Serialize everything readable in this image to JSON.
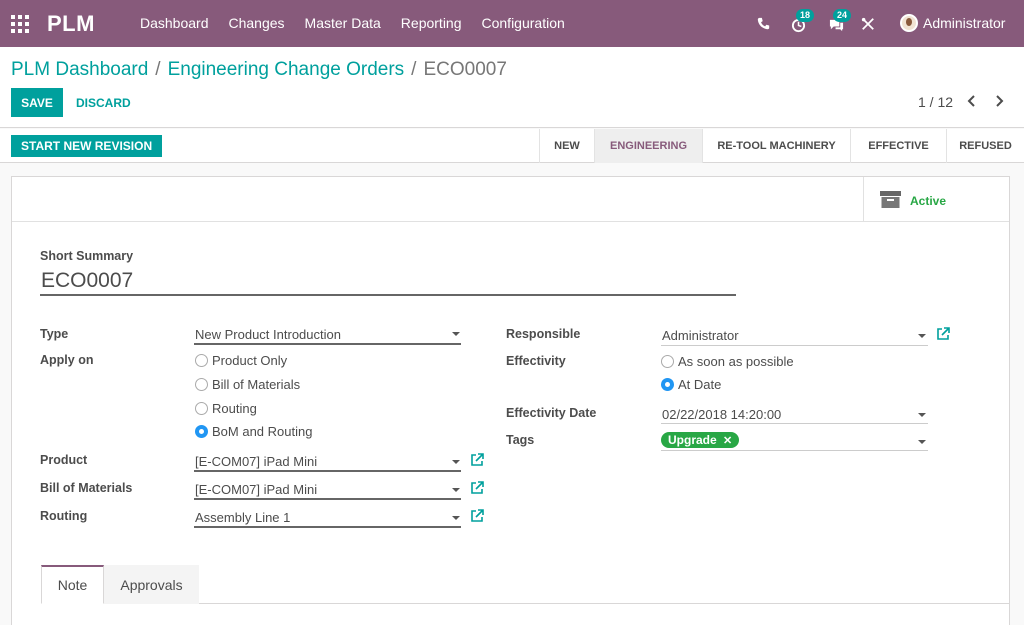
{
  "topbar": {
    "brand": "PLM",
    "menu": [
      "Dashboard",
      "Changes",
      "Master Data",
      "Reporting",
      "Configuration"
    ],
    "activities_count": "18",
    "messages_count": "24",
    "user_name": "Administrator"
  },
  "breadcrumb": {
    "items": [
      "PLM Dashboard",
      "Engineering Change Orders"
    ],
    "separator": "/",
    "current": "ECO0007"
  },
  "actions": {
    "save": "SAVE",
    "discard": "DISCARD"
  },
  "pager": {
    "value": "1 / 12"
  },
  "statusbar": {
    "button": "START NEW REVISION",
    "stages": [
      "NEW",
      "ENGINEERING",
      "RE-TOOL MACHINERY",
      "EFFECTIVE",
      "REFUSED"
    ],
    "active_stage": "ENGINEERING"
  },
  "stat_button": {
    "label": "Active",
    "icon": "archive-icon"
  },
  "form": {
    "short_summary_label": "Short Summary",
    "short_summary_value": "ECO0007",
    "type_label": "Type",
    "type_value": "New Product Introduction",
    "apply_on_label": "Apply on",
    "apply_on_options": [
      "Product Only",
      "Bill of Materials",
      "Routing",
      "BoM and Routing"
    ],
    "apply_on_selected": "BoM and Routing",
    "product_label": "Product",
    "product_value": "[E-COM07] iPad Mini",
    "bom_label": "Bill of Materials",
    "bom_value": "[E-COM07] iPad Mini",
    "routing_label": "Routing",
    "routing_value": "Assembly Line 1",
    "responsible_label": "Responsible",
    "responsible_value": "Administrator",
    "effectivity_label": "Effectivity",
    "effectivity_options": [
      "As soon as possible",
      "At Date"
    ],
    "effectivity_selected": "At Date",
    "effectivity_date_label": "Effectivity Date",
    "effectivity_date_value": "02/22/2018 14:20:00",
    "tags_label": "Tags",
    "tags": [
      "Upgrade"
    ]
  },
  "tabs": [
    "Note",
    "Approvals"
  ],
  "colors": {
    "brand": "#875a7b",
    "accent": "#00a09d",
    "success": "#28a745",
    "radio": "#2196f3"
  }
}
